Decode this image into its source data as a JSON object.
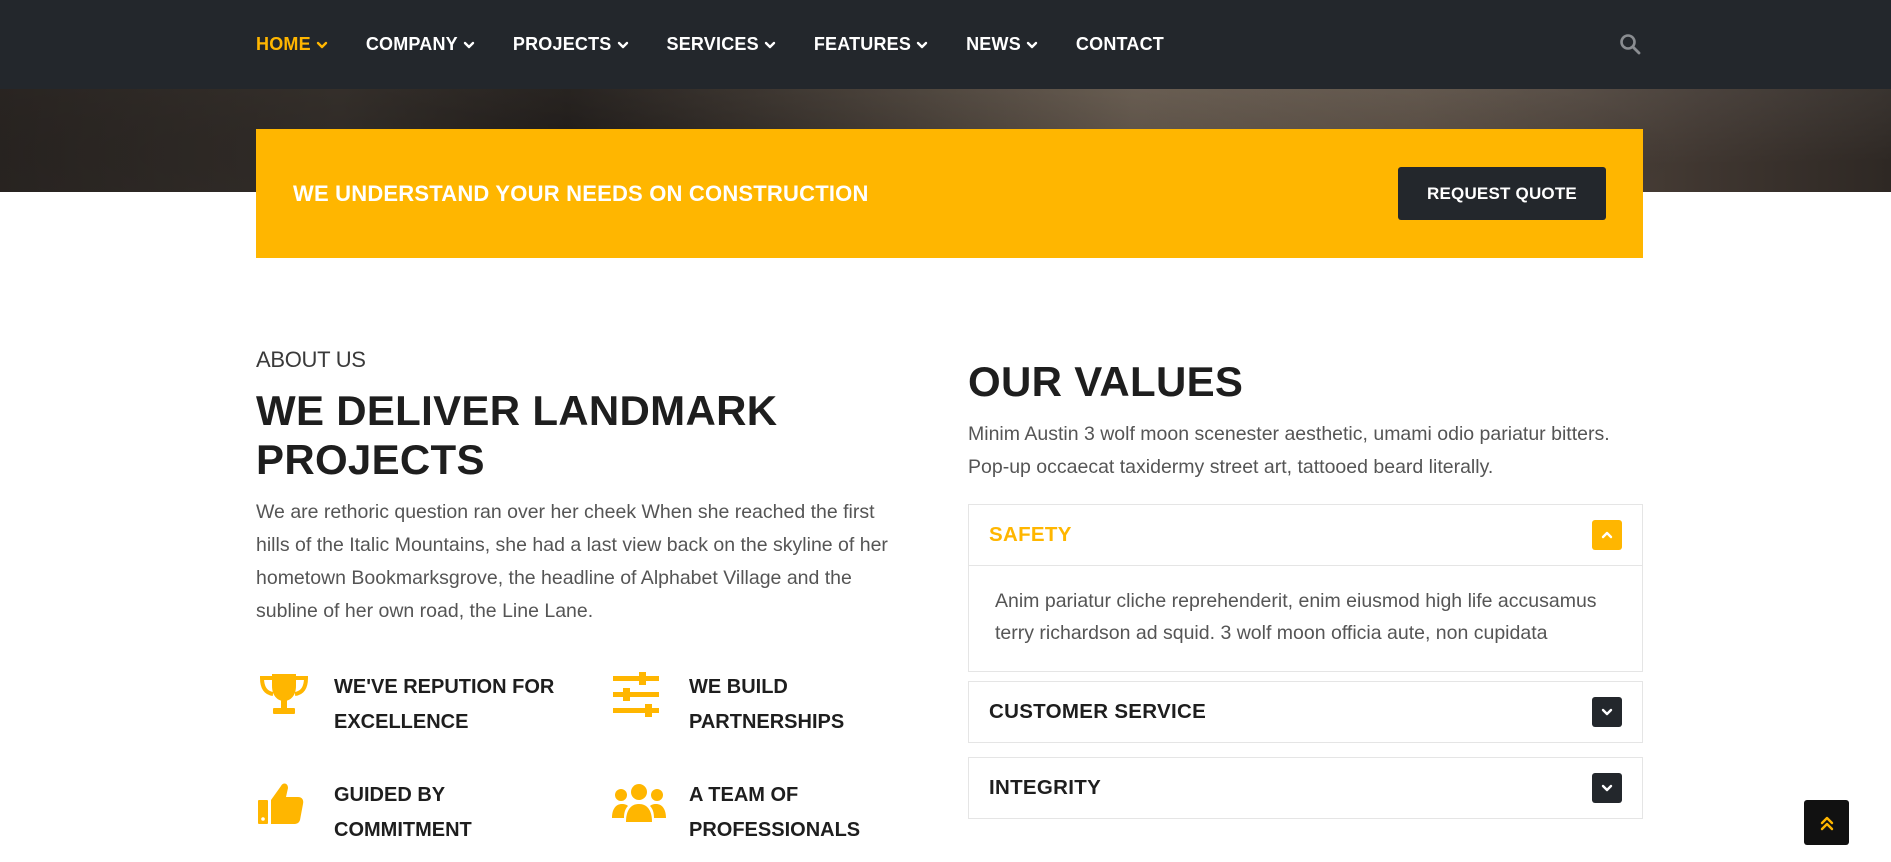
{
  "nav": {
    "items": [
      {
        "label": "HOME",
        "has_dropdown": true,
        "active": true
      },
      {
        "label": "COMPANY",
        "has_dropdown": true,
        "active": false
      },
      {
        "label": "PROJECTS",
        "has_dropdown": true,
        "active": false
      },
      {
        "label": "SERVICES",
        "has_dropdown": true,
        "active": false
      },
      {
        "label": "FEATURES",
        "has_dropdown": true,
        "active": false
      },
      {
        "label": "NEWS",
        "has_dropdown": true,
        "active": false
      },
      {
        "label": "CONTACT",
        "has_dropdown": false,
        "active": false
      }
    ],
    "search_icon": "search-icon"
  },
  "cta": {
    "text": "WE UNDERSTAND YOUR NEEDS ON CONSTRUCTION",
    "button_label": "REQUEST QUOTE"
  },
  "about": {
    "eyebrow": "ABOUT US",
    "title": "WE DELIVER LANDMARK PROJECTS",
    "body": "We are rethoric question ran over her cheek When she reached the first hills of the Italic Mountains, she had a last view back on the skyline of her hometown Bookmarksgrove, the headline of Alphabet Village and the subline of her own road, the Line Lane.",
    "features": [
      {
        "icon": "trophy-icon",
        "label": "WE'VE REPUTION FOR EXCELLENCE"
      },
      {
        "icon": "sliders-icon",
        "label": "WE BUILD PARTNERSHIPS"
      },
      {
        "icon": "thumbs-up-icon",
        "label": "GUIDED BY COMMITMENT"
      },
      {
        "icon": "users-icon",
        "label": "A TEAM OF PROFESSIONALS"
      }
    ]
  },
  "values": {
    "title": "OUR VALUES",
    "body": "Minim Austin 3 wolf moon scenester aesthetic, umami odio pariatur bitters. Pop-up occaecat taxidermy street art, tattooed beard literally.",
    "accordion": [
      {
        "title": "SAFETY",
        "open": true,
        "body": "Anim pariatur cliche reprehenderit, enim eiusmod high life accusamus terry richardson ad squid. 3 wolf moon officia aute, non cupidata"
      },
      {
        "title": "CUSTOMER SERVICE",
        "open": false
      },
      {
        "title": "INTEGRITY",
        "open": false
      }
    ]
  },
  "back_to_top_icon": "double-chevron-up-icon",
  "colors": {
    "accent": "#ffb600",
    "dark": "#23272c",
    "text": "#1e1e1e",
    "muted": "#555555"
  }
}
